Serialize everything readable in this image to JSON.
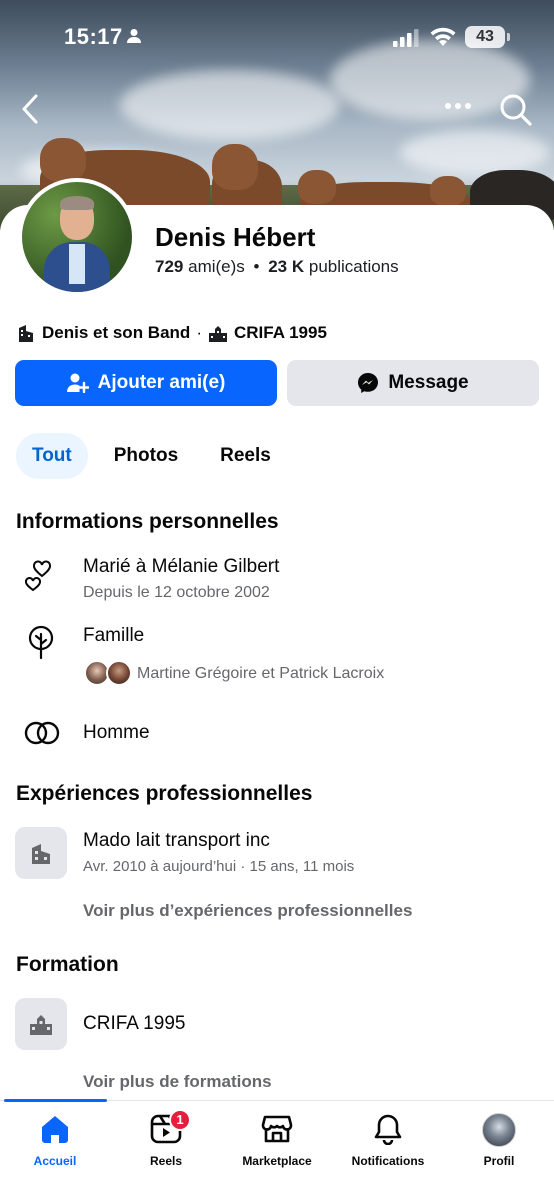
{
  "status_bar": {
    "time": "15:17",
    "battery": "43"
  },
  "profile": {
    "name": "Denis Hébert",
    "friends_count": "729",
    "friends_label": "ami(e)s",
    "separator": "•",
    "posts_count": "23 K",
    "posts_label": "publications",
    "affiliations": [
      "Denis et son Band",
      "CRIFA 1995"
    ],
    "affiliation_separator": "·"
  },
  "actions": {
    "add_friend": "Ajouter ami(e)",
    "message": "Message"
  },
  "tabs": [
    {
      "label": "Tout",
      "active": true
    },
    {
      "label": "Photos",
      "active": false
    },
    {
      "label": "Reels",
      "active": false
    }
  ],
  "personal_info": {
    "title": "Informations personnelles",
    "relationship": {
      "title": "Marié à Mélanie Gilbert",
      "subtitle": "Depuis le 12 octobre 2002"
    },
    "family": {
      "title": "Famille",
      "members": "Martine Grégoire et Patrick Lacroix"
    },
    "gender": "Homme"
  },
  "work": {
    "title": "Expériences professionnelles",
    "items": [
      {
        "title": "Mado lait transport inc",
        "subtitle": "Avr. 2010 à aujourd’hui · 15 ans, 11 mois"
      }
    ],
    "see_more": "Voir plus d’expériences professionnelles"
  },
  "education": {
    "title": "Formation",
    "items": [
      {
        "title": "CRIFA 1995"
      }
    ],
    "see_more": "Voir plus de formations"
  },
  "bottom_nav": [
    {
      "label": "Accueil",
      "icon": "home-icon",
      "active": true
    },
    {
      "label": "Reels",
      "icon": "reels-icon",
      "badge": "1"
    },
    {
      "label": "Marketplace",
      "icon": "marketplace-icon"
    },
    {
      "label": "Notifications",
      "icon": "bell-icon"
    },
    {
      "label": "Profil",
      "icon": "profile-avatar"
    }
  ],
  "colors": {
    "accent": "#0866ff",
    "active_tab_bg": "#ebf5ff",
    "badge": "#e41e3f",
    "muted_text": "#65676b"
  }
}
